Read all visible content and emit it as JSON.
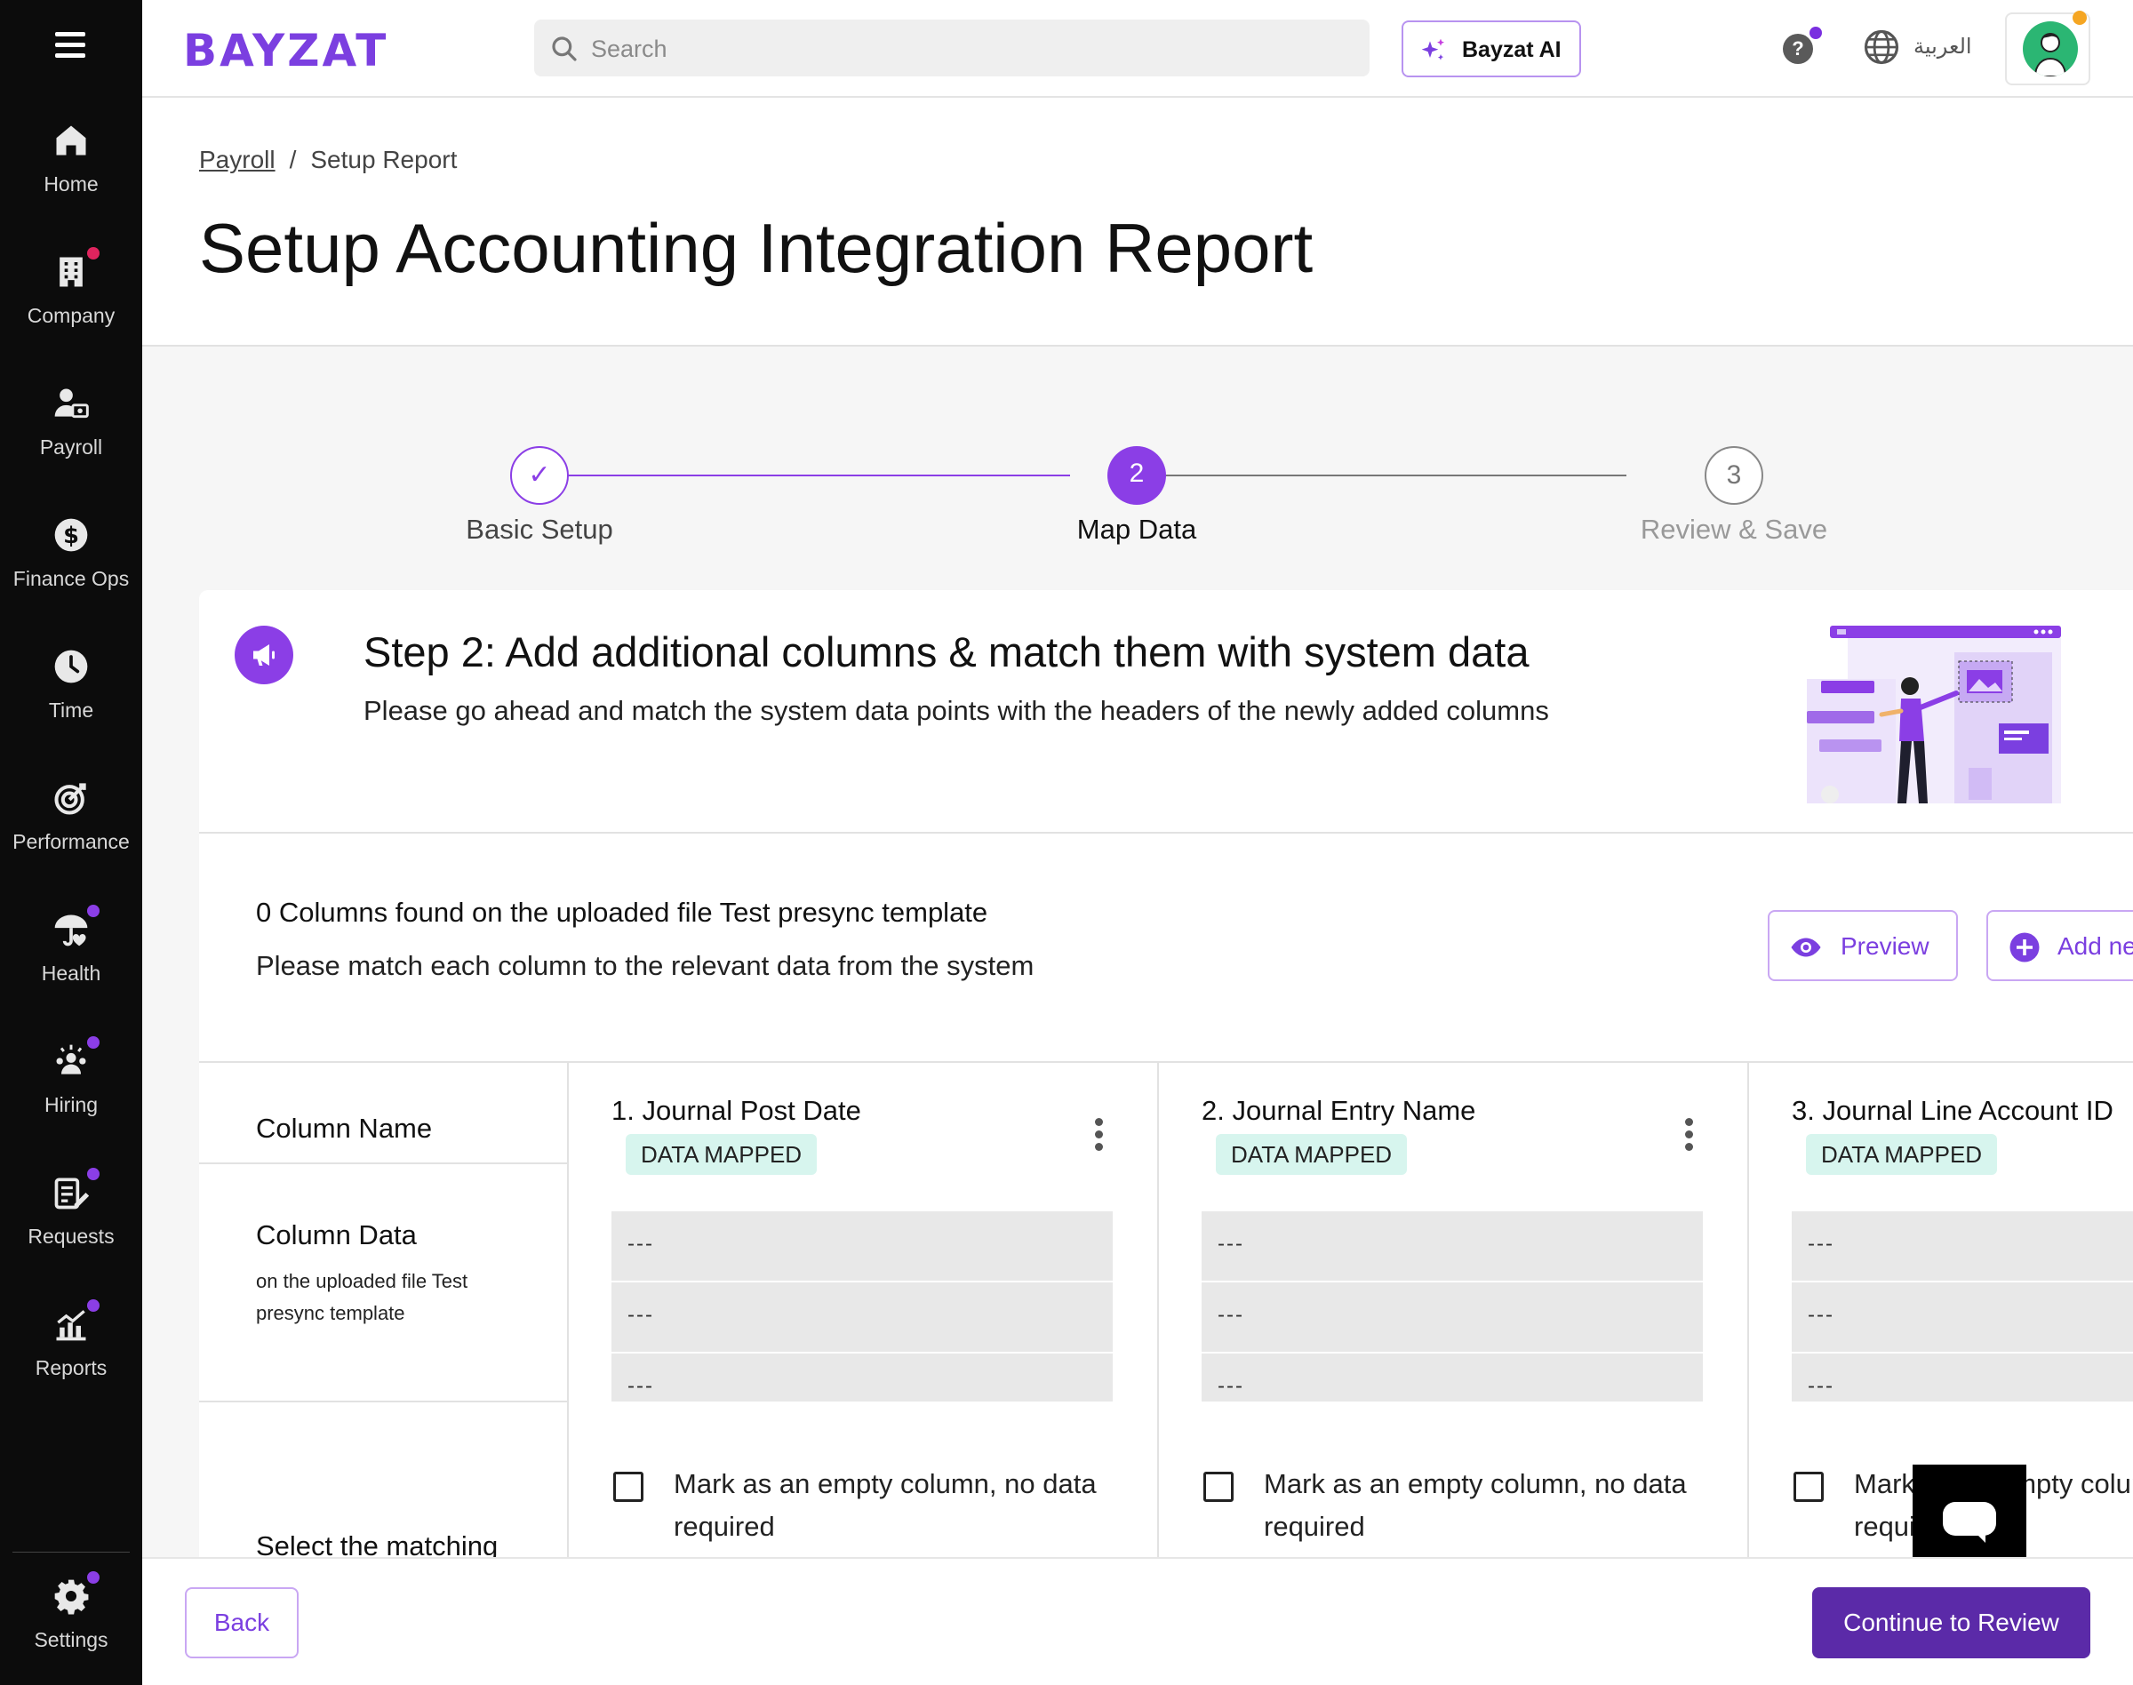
{
  "app": {
    "logo_text": "BAYZAT",
    "brand_color": "#7b3fe0"
  },
  "sidebar": {
    "items": [
      {
        "label": "Home",
        "icon": "home-icon"
      },
      {
        "label": "Company",
        "icon": "building-icon"
      },
      {
        "label": "Payroll",
        "icon": "payroll-icon"
      },
      {
        "label": "Finance Ops",
        "icon": "dollar-icon"
      },
      {
        "label": "Time",
        "icon": "clock-icon"
      },
      {
        "label": "Performance",
        "icon": "target-icon"
      },
      {
        "label": "Health",
        "icon": "umbrella-heart-icon"
      },
      {
        "label": "Hiring",
        "icon": "people-icon"
      },
      {
        "label": "Requests",
        "icon": "clipboard-edit-icon"
      },
      {
        "label": "Reports",
        "icon": "chart-icon"
      }
    ],
    "settings_label": "Settings"
  },
  "topbar": {
    "search_placeholder": "Search",
    "ai_label": "Bayzat AI",
    "help_label": "?",
    "language_label": "العربية"
  },
  "breadcrumb": {
    "parent": "Payroll",
    "separator": "/",
    "current": "Setup Report"
  },
  "page_title": "Setup Accounting Integration Report",
  "stepper": {
    "steps": [
      {
        "number": "✓",
        "label": "Basic Setup",
        "state": "done"
      },
      {
        "number": "2",
        "label": "Map Data",
        "state": "active"
      },
      {
        "number": "3",
        "label": "Review & Save",
        "state": "pending"
      }
    ]
  },
  "card": {
    "title": "Step 2: Add additional columns & match them with system data",
    "description": "Please go ahead and match the system data points with the headers of the newly added columns",
    "columns_found": "0 Columns found on the uploaded file Test presync template",
    "columns_instruction": "Please match each column to the relevant data from the system",
    "preview_label": "Preview",
    "add_label": "Add ne"
  },
  "mapping": {
    "row_labels": {
      "column_name": "Column Name",
      "column_data": "Column Data",
      "column_data_sub": "on the uploaded file Test presync template",
      "select_matching": "Select the matching"
    },
    "columns": [
      {
        "title": "1. Journal Post Date",
        "badge": "DATA MAPPED",
        "cells": [
          "---",
          "---",
          "---"
        ],
        "empty_label": "Mark as an empty column, no data required"
      },
      {
        "title": "2. Journal Entry Name",
        "badge": "DATA MAPPED",
        "cells": [
          "---",
          "---",
          "---"
        ],
        "empty_label": "Mark as an empty column, no data required"
      },
      {
        "title": "3. Journal Line Account ID",
        "badge": "DATA MAPPED",
        "cells": [
          "---",
          "---",
          "---"
        ],
        "empty_label": "Mark as an empty column, no data required"
      }
    ]
  },
  "footer": {
    "back_label": "Back",
    "continue_label": "Continue to Review"
  }
}
